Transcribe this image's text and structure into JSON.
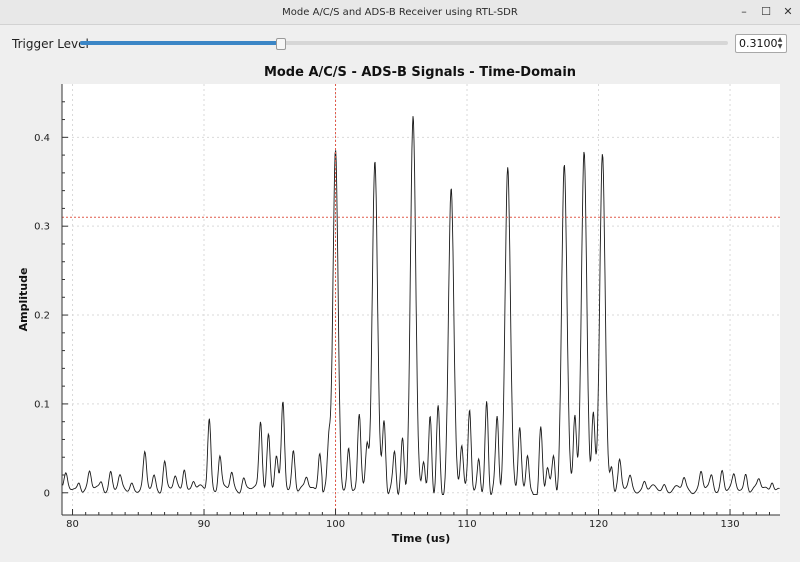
{
  "window": {
    "title": "Mode A/C/S and ADS-B Receiver using RTL-SDR",
    "controls": [
      "–",
      "☐",
      "✕"
    ]
  },
  "trigger": {
    "label": "Trigger Level",
    "value": "0.3100",
    "slider_fraction": 0.31
  },
  "chart_data": {
    "type": "line",
    "title": "Mode A/C/S - ADS-B Signals - Time-Domain",
    "xlabel": "Time (us)",
    "ylabel": "Amplitude",
    "xlim": [
      79.2,
      133.8
    ],
    "ylim": [
      -0.025,
      0.46
    ],
    "xticks": [
      80,
      90,
      100,
      110,
      120,
      130
    ],
    "yticks": [
      0,
      0.1,
      0.2,
      0.3,
      0.4
    ],
    "grid": true,
    "threshold": 0.31,
    "marker_x": 100,
    "line_color": "#1a1a1a",
    "marker_color": "#e05a4a",
    "pulses": [
      {
        "x": 100.0,
        "h": 0.378
      },
      {
        "x": 103.0,
        "h": 0.38
      },
      {
        "x": 105.9,
        "h": 0.425
      },
      {
        "x": 108.8,
        "h": 0.351
      },
      {
        "x": 113.1,
        "h": 0.375
      },
      {
        "x": 117.4,
        "h": 0.377
      },
      {
        "x": 118.9,
        "h": 0.393
      },
      {
        "x": 120.3,
        "h": 0.389
      }
    ],
    "small_peaks": [
      [
        79.5,
        0.014
      ],
      [
        80.5,
        0.01
      ],
      [
        81.3,
        0.018
      ],
      [
        82.2,
        0.009
      ],
      [
        82.9,
        0.02
      ],
      [
        83.6,
        0.012
      ],
      [
        84.5,
        0.008
      ],
      [
        85.5,
        0.038
      ],
      [
        86.2,
        0.015
      ],
      [
        87.0,
        0.032
      ],
      [
        87.8,
        0.012
      ],
      [
        88.5,
        0.026
      ],
      [
        89.2,
        0.01
      ],
      [
        90.4,
        0.081
      ],
      [
        91.2,
        0.038
      ],
      [
        92.1,
        0.018
      ],
      [
        93.0,
        0.014
      ],
      [
        94.3,
        0.077
      ],
      [
        94.9,
        0.063
      ],
      [
        95.5,
        0.036
      ],
      [
        96.0,
        0.097
      ],
      [
        96.8,
        0.046
      ],
      [
        97.8,
        0.012
      ],
      [
        98.8,
        0.045
      ],
      [
        99.5,
        0.06
      ],
      [
        101.0,
        0.059
      ],
      [
        101.8,
        0.091
      ],
      [
        102.4,
        0.061
      ],
      [
        103.7,
        0.079
      ],
      [
        104.5,
        0.052
      ],
      [
        105.1,
        0.063
      ],
      [
        106.7,
        0.045
      ],
      [
        107.2,
        0.087
      ],
      [
        107.8,
        0.09
      ],
      [
        109.6,
        0.058
      ],
      [
        110.2,
        0.096
      ],
      [
        110.9,
        0.047
      ],
      [
        111.5,
        0.102
      ],
      [
        112.3,
        0.087
      ],
      [
        114.0,
        0.075
      ],
      [
        114.6,
        0.049
      ],
      [
        115.6,
        0.069
      ],
      [
        116.1,
        0.033
      ],
      [
        116.6,
        0.045
      ],
      [
        118.2,
        0.09
      ],
      [
        119.6,
        0.098
      ],
      [
        121.0,
        0.04
      ],
      [
        121.6,
        0.032
      ],
      [
        122.4,
        0.012
      ],
      [
        123.5,
        0.01
      ],
      [
        125.0,
        0.006
      ],
      [
        126.5,
        0.012
      ],
      [
        127.8,
        0.019
      ],
      [
        128.6,
        0.014
      ],
      [
        129.4,
        0.022
      ],
      [
        130.3,
        0.013
      ],
      [
        131.2,
        0.019
      ],
      [
        132.2,
        0.01
      ],
      [
        133.2,
        0.012
      ]
    ]
  }
}
